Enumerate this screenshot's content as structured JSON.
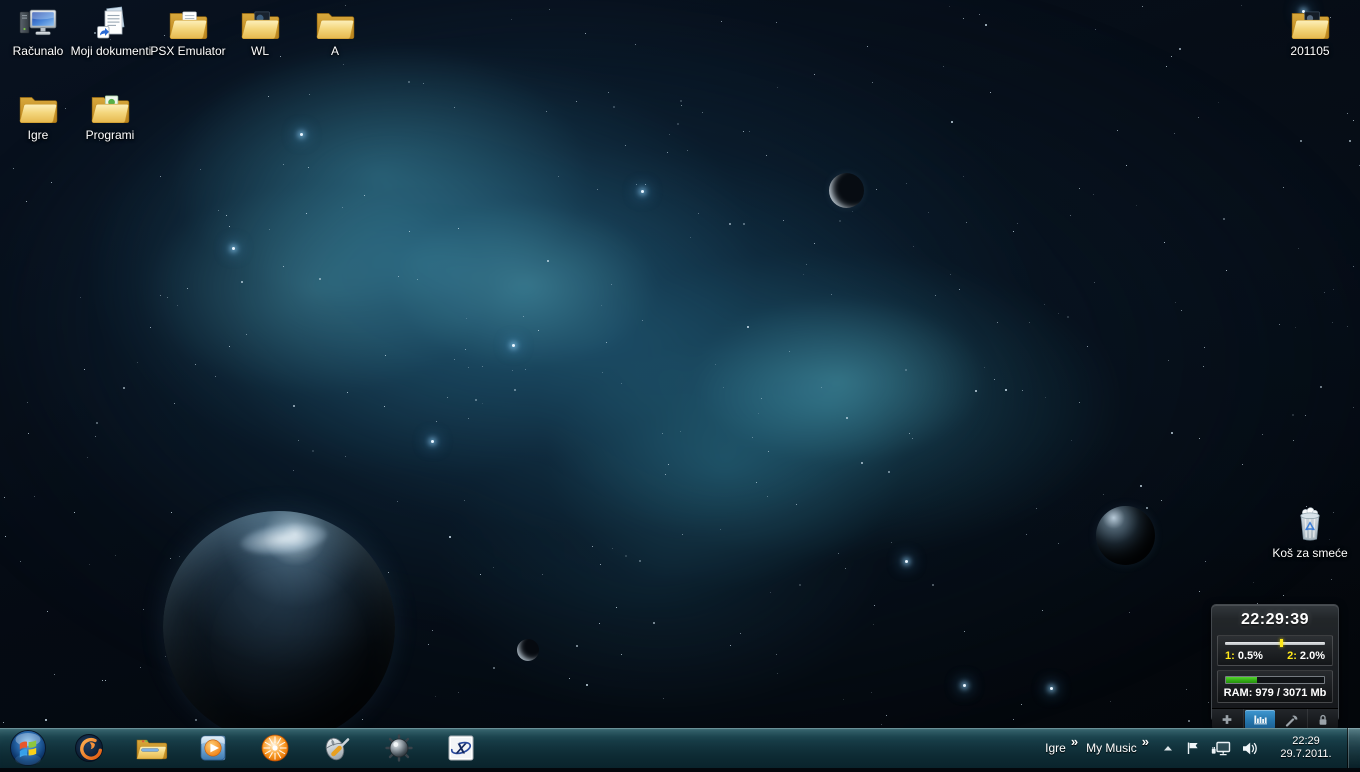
{
  "desktop": {
    "icons": [
      {
        "name": "computer",
        "label": "Računalo"
      },
      {
        "name": "my-documents",
        "label": "Moji dokumenti"
      },
      {
        "name": "psx-emulator-folder",
        "label": "PSX Emulator"
      },
      {
        "name": "wl-folder",
        "label": "WL"
      },
      {
        "name": "a-folder",
        "label": "A"
      },
      {
        "name": "folder-201105",
        "label": "201105"
      },
      {
        "name": "igre-folder",
        "label": "Igre"
      },
      {
        "name": "programi-folder",
        "label": "Programi"
      },
      {
        "name": "recycle-bin",
        "label": "Koš za smeće"
      }
    ]
  },
  "gadget": {
    "clock_time": "22:29:39",
    "cpu": {
      "core1_label": "1:",
      "core1_value": "0.5%",
      "core2_label": "2:",
      "core2_value": "2.0%",
      "marker_percent": 55
    },
    "ram": {
      "label": "RAM: 979 / 3071 Mb",
      "used_mb": 979,
      "total_mb": 3071,
      "percent": 31.9
    },
    "buttons": [
      "add",
      "graph",
      "settings",
      "lock"
    ],
    "active_button": "graph",
    "colors": {
      "accent_yellow": "#ffe81a",
      "ram_green": "#34ad16",
      "active_blue": "#2676ad"
    }
  },
  "taskbar": {
    "app_buttons": [
      "start",
      "phoenix-app",
      "windows-explorer",
      "windows-media-player",
      "bitcomet",
      "mouse-tool",
      "minesweeper",
      "x-app"
    ],
    "toolbars": [
      {
        "label": "Igre",
        "chevron": "»"
      },
      {
        "label": "My Music",
        "chevron": "»"
      }
    ],
    "tray": {
      "time": "22:29",
      "date": "29.7.2011."
    }
  }
}
